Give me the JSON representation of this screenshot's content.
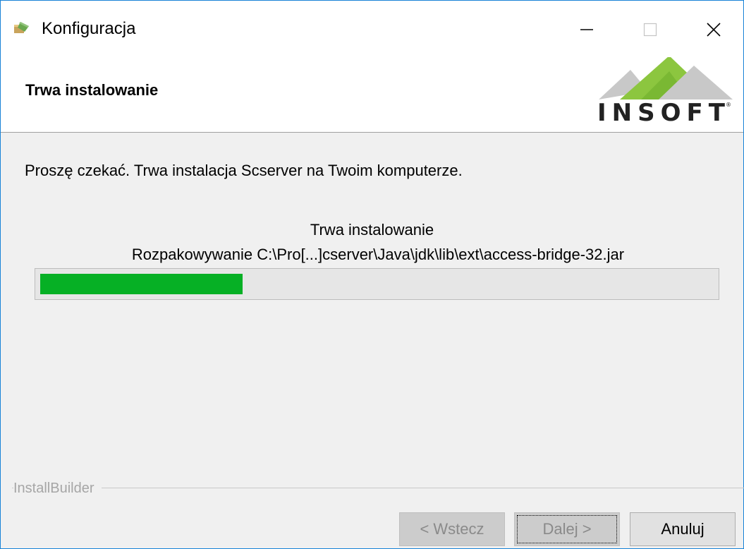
{
  "window": {
    "title": "Konfiguracja"
  },
  "header": {
    "title": "Trwa instalowanie",
    "logo_text": "INSOFT",
    "logo_mark": "®"
  },
  "main": {
    "message": "Proszę czekać. Trwa instalacja Scserver na Twoim komputerze.",
    "status_title": "Trwa instalowanie",
    "status_detail": "Rozpakowywanie C:\\Pro[...]cserver\\Java\\jdk\\lib\\ext\\access-bridge-32.jar",
    "progress_fraction": 0.3
  },
  "footer": {
    "brand": "InstallBuilder",
    "back_label": "< Wstecz",
    "next_label": "Dalej >",
    "cancel_label": "Anuluj"
  },
  "colors": {
    "progress_fill": "#06b025",
    "window_border": "#1883d7",
    "logo_green": "#8cc63f",
    "logo_gray": "#c8c8c8"
  },
  "icons": {
    "app": "installer-app-icon",
    "minimize": "minimize-icon",
    "maximize": "maximize-icon",
    "close": "close-icon"
  }
}
